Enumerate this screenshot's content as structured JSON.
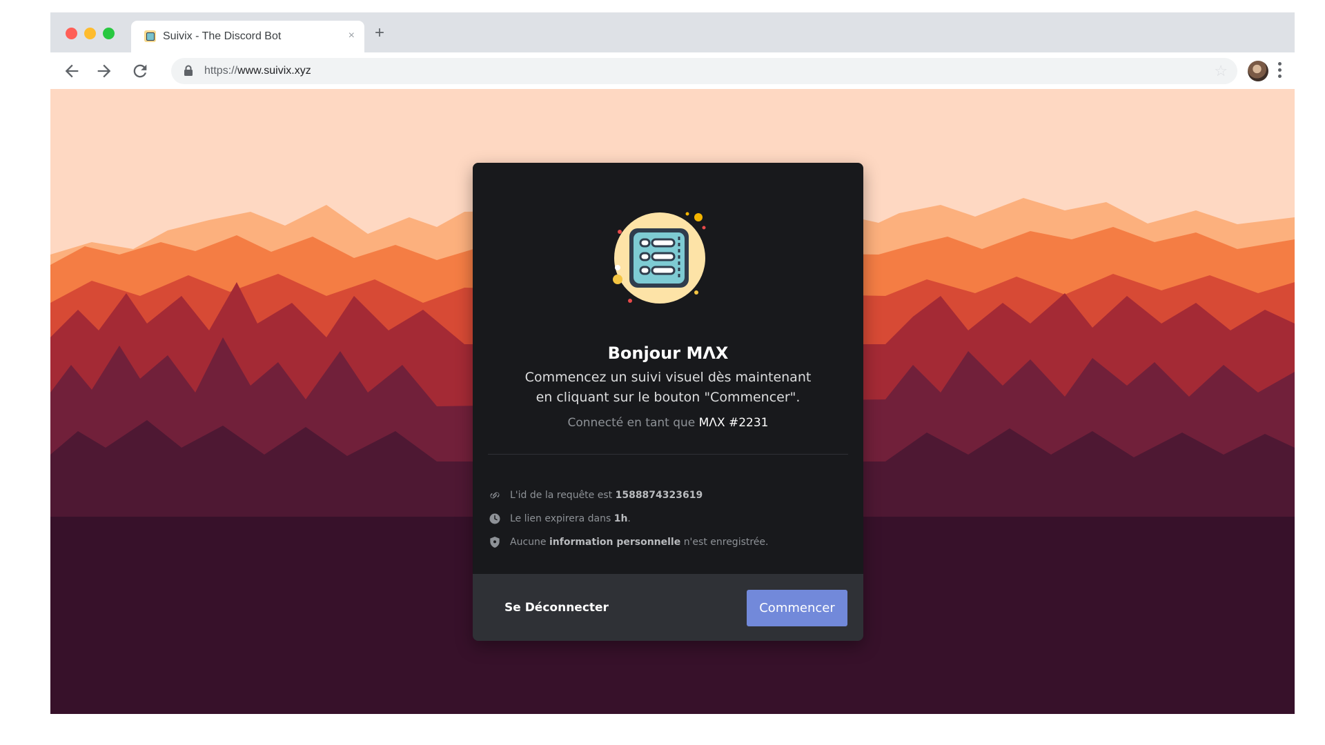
{
  "browser": {
    "tab_title": "Suivix - The Discord Bot",
    "tab_close": "×",
    "new_tab": "+",
    "url_scheme": "https://",
    "url_host": "www.suivix.xyz",
    "star_glyph": "☆"
  },
  "card": {
    "greeting": "Bonjour MΛX",
    "subtitle_line1": "Commencez un suivi visuel dès maintenant",
    "subtitle_line2": "en cliquant sur le bouton \"Commencer\".",
    "connected_prefix": "Connecté en tant que",
    "connected_user": "MΛX #2231",
    "info": {
      "request_prefix": "L'id de la requête est",
      "request_id": "1588874323619",
      "expire_prefix": "Le lien expirera dans",
      "expire_value": "1h",
      "expire_suffix": ".",
      "privacy_prefix": "Aucune",
      "privacy_bold": "information personnelle",
      "privacy_suffix": "n'est enregistrée."
    },
    "logout_label": "Se Déconnecter",
    "start_label": "Commencer"
  },
  "colors": {
    "accent": "#7289da",
    "card_bg": "#18191c",
    "footer_bg": "#2f3136",
    "sky": "#fed8c2"
  },
  "icons": {
    "link": "link-icon",
    "clock": "clock-icon",
    "shield": "shield-icon",
    "lock": "lock-icon"
  }
}
